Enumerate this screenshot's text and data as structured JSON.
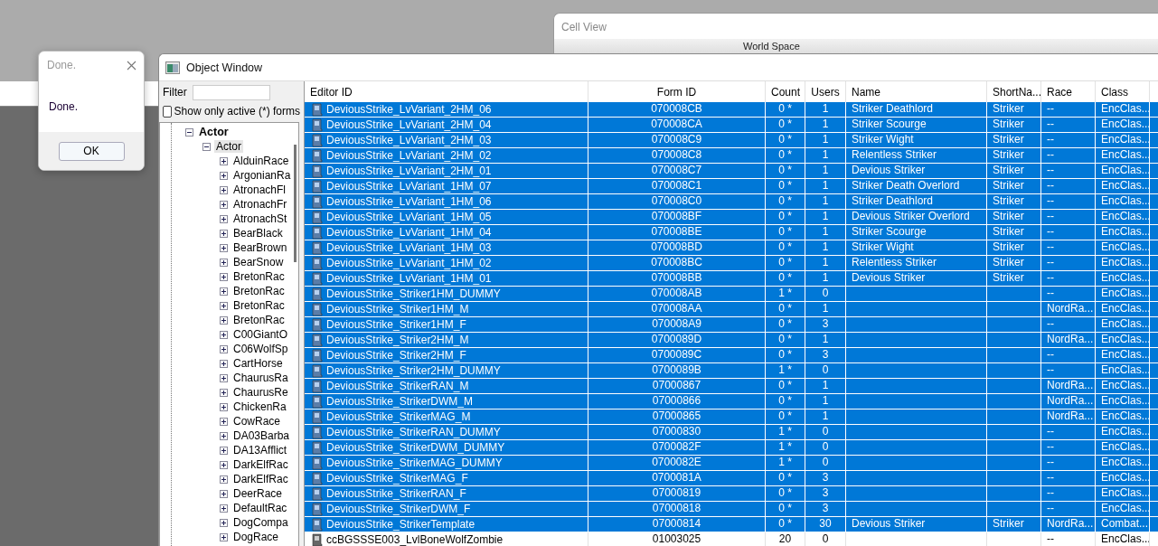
{
  "cell_view": {
    "title": "Cell View",
    "label": "World Space"
  },
  "dialog": {
    "title": "Done.",
    "message": "Done.",
    "button": "OK"
  },
  "object_window": {
    "title": "Object Window",
    "filter": {
      "label": "Filter"
    },
    "active_only": {
      "label": "Show only active (*) forms",
      "checked": false
    },
    "tree": [
      {
        "label": "Actor",
        "expanded": true,
        "selected": false,
        "children": [
          {
            "label": "Actor",
            "expanded": true,
            "selected": true,
            "children": [
              {
                "label": "AlduinRace",
                "expanded": false,
                "selected": false
              },
              {
                "label": "ArgonianRa",
                "expanded": false,
                "selected": false
              },
              {
                "label": "AtronachFl",
                "expanded": false,
                "selected": false
              },
              {
                "label": "AtronachFr",
                "expanded": false,
                "selected": false
              },
              {
                "label": "AtronachSt",
                "expanded": false,
                "selected": false
              },
              {
                "label": "BearBlack",
                "expanded": false,
                "selected": false
              },
              {
                "label": "BearBrown",
                "expanded": false,
                "selected": false
              },
              {
                "label": "BearSnow",
                "expanded": false,
                "selected": false
              },
              {
                "label": "BretonRac",
                "expanded": false,
                "selected": false
              },
              {
                "label": "BretonRac",
                "expanded": false,
                "selected": false
              },
              {
                "label": "BretonRac",
                "expanded": false,
                "selected": false
              },
              {
                "label": "BretonRac",
                "expanded": false,
                "selected": false
              },
              {
                "label": "C00GiantO",
                "expanded": false,
                "selected": false
              },
              {
                "label": "C06WolfSp",
                "expanded": false,
                "selected": false
              },
              {
                "label": "CartHorse",
                "expanded": false,
                "selected": false
              },
              {
                "label": "ChaurusRa",
                "expanded": false,
                "selected": false
              },
              {
                "label": "ChaurusRe",
                "expanded": false,
                "selected": false
              },
              {
                "label": "ChickenRa",
                "expanded": false,
                "selected": false
              },
              {
                "label": "CowRace",
                "expanded": false,
                "selected": false
              },
              {
                "label": "DA03Barba",
                "expanded": false,
                "selected": false
              },
              {
                "label": "DA13Afflict",
                "expanded": false,
                "selected": false
              },
              {
                "label": "DarkElfRac",
                "expanded": false,
                "selected": false
              },
              {
                "label": "DarkElfRac",
                "expanded": false,
                "selected": false
              },
              {
                "label": "DeerRace",
                "expanded": false,
                "selected": false
              },
              {
                "label": "DefaultRac",
                "expanded": false,
                "selected": false
              },
              {
                "label": "DogCompa",
                "expanded": false,
                "selected": false
              },
              {
                "label": "DogRace",
                "expanded": false,
                "selected": false
              }
            ]
          }
        ]
      }
    ],
    "table": {
      "columns": [
        "Editor ID",
        "Form ID",
        "Count",
        "Users",
        "Name",
        "ShortNa...",
        "Race",
        "Class"
      ],
      "rows": [
        {
          "editor_id": "DeviousStrike_LvVariant_2HM_06",
          "form_id": "070008CB",
          "count": "0 *",
          "users": "1",
          "name": "Striker Deathlord",
          "short_name": "Striker",
          "race": "--",
          "class": "EncClas...",
          "selected": true
        },
        {
          "editor_id": "DeviousStrike_LvVariant_2HM_04",
          "form_id": "070008CA",
          "count": "0 *",
          "users": "1",
          "name": "Striker Scourge",
          "short_name": "Striker",
          "race": "--",
          "class": "EncClas...",
          "selected": true
        },
        {
          "editor_id": "DeviousStrike_LvVariant_2HM_03",
          "form_id": "070008C9",
          "count": "0 *",
          "users": "1",
          "name": "Striker Wight",
          "short_name": "Striker",
          "race": "--",
          "class": "EncClas...",
          "selected": true
        },
        {
          "editor_id": "DeviousStrike_LvVariant_2HM_02",
          "form_id": "070008C8",
          "count": "0 *",
          "users": "1",
          "name": "Relentless Striker",
          "short_name": "Striker",
          "race": "--",
          "class": "EncClas...",
          "selected": true
        },
        {
          "editor_id": "DeviousStrike_LvVariant_2HM_01",
          "form_id": "070008C7",
          "count": "0 *",
          "users": "1",
          "name": "Devious Striker",
          "short_name": "Striker",
          "race": "--",
          "class": "EncClas...",
          "selected": true
        },
        {
          "editor_id": "DeviousStrike_LvVariant_1HM_07",
          "form_id": "070008C1",
          "count": "0 *",
          "users": "1",
          "name": "Striker Death Overlord",
          "short_name": "Striker",
          "race": "--",
          "class": "EncClas...",
          "selected": true
        },
        {
          "editor_id": "DeviousStrike_LvVariant_1HM_06",
          "form_id": "070008C0",
          "count": "0 *",
          "users": "1",
          "name": "Striker Deathlord",
          "short_name": "Striker",
          "race": "--",
          "class": "EncClas...",
          "selected": true
        },
        {
          "editor_id": "DeviousStrike_LvVariant_1HM_05",
          "form_id": "070008BF",
          "count": "0 *",
          "users": "1",
          "name": "Devious Striker Overlord",
          "short_name": "Striker",
          "race": "--",
          "class": "EncClas...",
          "selected": true
        },
        {
          "editor_id": "DeviousStrike_LvVariant_1HM_04",
          "form_id": "070008BE",
          "count": "0 *",
          "users": "1",
          "name": "Striker Scourge",
          "short_name": "Striker",
          "race": "--",
          "class": "EncClas...",
          "selected": true
        },
        {
          "editor_id": "DeviousStrike_LvVariant_1HM_03",
          "form_id": "070008BD",
          "count": "0 *",
          "users": "1",
          "name": "Striker Wight",
          "short_name": "Striker",
          "race": "--",
          "class": "EncClas...",
          "selected": true
        },
        {
          "editor_id": "DeviousStrike_LvVariant_1HM_02",
          "form_id": "070008BC",
          "count": "0 *",
          "users": "1",
          "name": "Relentless Striker",
          "short_name": "Striker",
          "race": "--",
          "class": "EncClas...",
          "selected": true
        },
        {
          "editor_id": "DeviousStrike_LvVariant_1HM_01",
          "form_id": "070008BB",
          "count": "0 *",
          "users": "1",
          "name": "Devious Striker",
          "short_name": "Striker",
          "race": "--",
          "class": "EncClas...",
          "selected": true
        },
        {
          "editor_id": "DeviousStrike_Striker1HM_DUMMY",
          "form_id": "070008AB",
          "count": "1 *",
          "users": "0",
          "race": "--",
          "class": "EncClas...",
          "selected": true
        },
        {
          "editor_id": "DeviousStrike_Striker1HM_M",
          "form_id": "070008AA",
          "count": "0 *",
          "users": "1",
          "race": "NordRa...",
          "class": "EncClas...",
          "selected": true
        },
        {
          "editor_id": "DeviousStrike_Striker1HM_F",
          "form_id": "070008A9",
          "count": "0 *",
          "users": "3",
          "race": "--",
          "class": "EncClas...",
          "selected": true
        },
        {
          "editor_id": "DeviousStrike_Striker2HM_M",
          "form_id": "0700089D",
          "count": "0 *",
          "users": "1",
          "race": "NordRa...",
          "class": "EncClas...",
          "selected": true
        },
        {
          "editor_id": "DeviousStrike_Striker2HM_F",
          "form_id": "0700089C",
          "count": "0 *",
          "users": "3",
          "race": "--",
          "class": "EncClas...",
          "selected": true
        },
        {
          "editor_id": "DeviousStrike_Striker2HM_DUMMY",
          "form_id": "0700089B",
          "count": "1 *",
          "users": "0",
          "race": "--",
          "class": "EncClas...",
          "selected": true
        },
        {
          "editor_id": "DeviousStrike_StrikerRAN_M",
          "form_id": "07000867",
          "count": "0 *",
          "users": "1",
          "race": "NordRa...",
          "class": "EncClas...",
          "selected": true
        },
        {
          "editor_id": "DeviousStrike_StrikerDWM_M",
          "form_id": "07000866",
          "count": "0 *",
          "users": "1",
          "race": "NordRa...",
          "class": "EncClas...",
          "selected": true
        },
        {
          "editor_id": "DeviousStrike_StrikerMAG_M",
          "form_id": "07000865",
          "count": "0 *",
          "users": "1",
          "race": "NordRa...",
          "class": "EncClas...",
          "selected": true
        },
        {
          "editor_id": "DeviousStrike_StrikerRAN_DUMMY",
          "form_id": "07000830",
          "count": "1 *",
          "users": "0",
          "race": "--",
          "class": "EncClas...",
          "selected": true
        },
        {
          "editor_id": "DeviousStrike_StrikerDWM_DUMMY",
          "form_id": "0700082F",
          "count": "1 *",
          "users": "0",
          "race": "--",
          "class": "EncClas...",
          "selected": true
        },
        {
          "editor_id": "DeviousStrike_StrikerMAG_DUMMY",
          "form_id": "0700082E",
          "count": "1 *",
          "users": "0",
          "race": "--",
          "class": "EncClas...",
          "selected": true
        },
        {
          "editor_id": "DeviousStrike_StrikerMAG_F",
          "form_id": "0700081A",
          "count": "0 *",
          "users": "3",
          "race": "--",
          "class": "EncClas...",
          "selected": true
        },
        {
          "editor_id": "DeviousStrike_StrikerRAN_F",
          "form_id": "07000819",
          "count": "0 *",
          "users": "3",
          "race": "--",
          "class": "EncClas...",
          "selected": true
        },
        {
          "editor_id": "DeviousStrike_StrikerDWM_F",
          "form_id": "07000818",
          "count": "0 *",
          "users": "3",
          "race": "--",
          "class": "EncClas...",
          "selected": true
        },
        {
          "editor_id": "DeviousStrike_StrikerTemplate",
          "form_id": "07000814",
          "count": "0 *",
          "users": "30",
          "name": "Devious Striker",
          "short_name": "Striker",
          "race": "NordRa...",
          "class": "Combat...",
          "selected": true
        },
        {
          "editor_id": "ccBGSSSE003_LvlBoneWolfZombie",
          "form_id": "01003025",
          "count": "20",
          "users": "0",
          "race": "--",
          "class": "EncClas...",
          "selected": false
        }
      ]
    }
  }
}
